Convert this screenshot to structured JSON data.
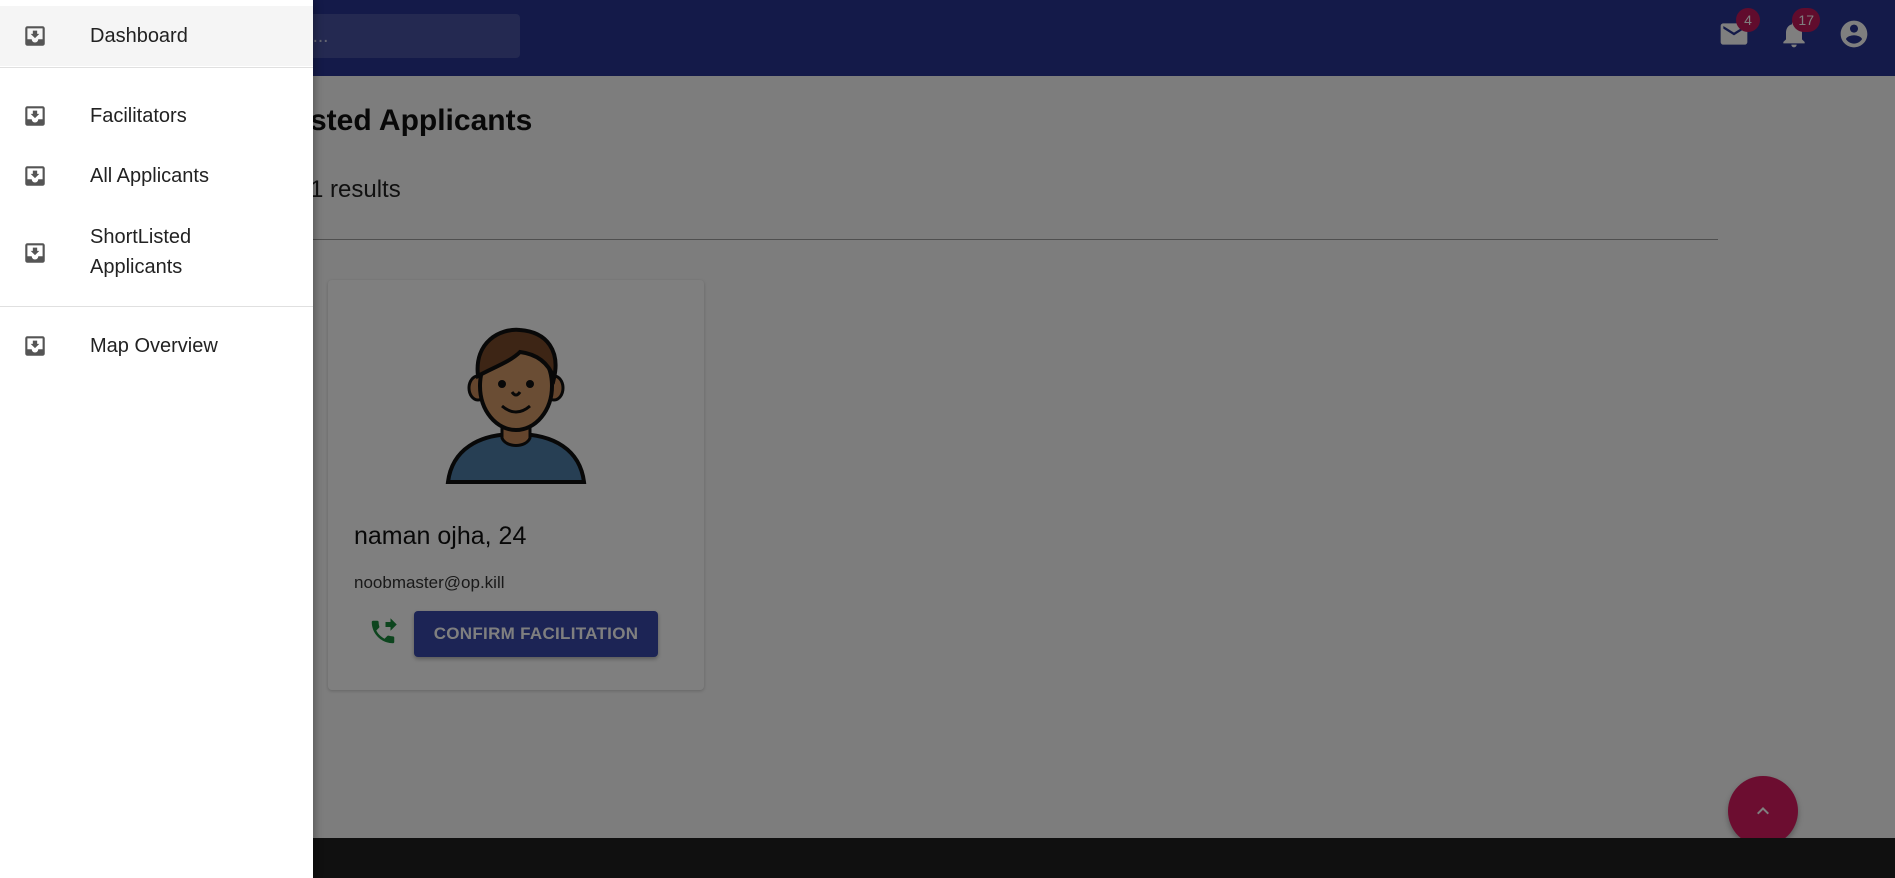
{
  "header": {
    "search_placeholder": "h...",
    "mail_badge": "4",
    "notifications_badge": "17",
    "background_color": "#283593"
  },
  "main": {
    "page_title": "sted Applicants",
    "results_count": "1 results",
    "card": {
      "name": "naman ojha, 24",
      "email": "noobmaster@op.kill",
      "confirm_label": "CONFIRM FACILITATION"
    }
  },
  "drawer": {
    "items": [
      {
        "label": "Dashboard",
        "icon": "inbox-download-icon"
      },
      {
        "label": "Facilitators",
        "icon": "inbox-download-icon"
      },
      {
        "label": "All Applicants",
        "icon": "inbox-download-icon"
      },
      {
        "label": "ShortListed\nApplicants",
        "icon": "inbox-download-icon"
      },
      {
        "label": "Map Overview",
        "icon": "inbox-download-icon"
      }
    ]
  },
  "colors": {
    "accent_pink": "#d81b60",
    "button_indigo": "#3949ab",
    "call_green": "#1b8a3c"
  }
}
